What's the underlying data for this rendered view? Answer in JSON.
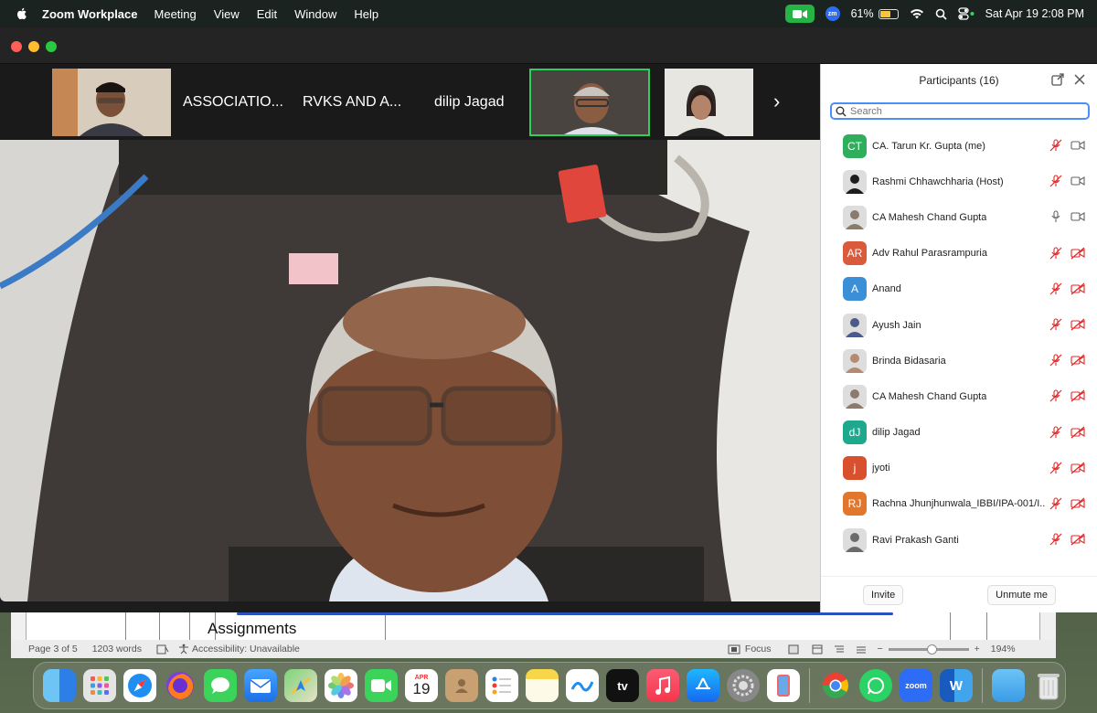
{
  "menubar": {
    "app_name": "Zoom Workplace",
    "menus": [
      "Meeting",
      "View",
      "Edit",
      "Window",
      "Help"
    ],
    "zm_badge": "zm",
    "battery_percent": "61%",
    "battery_level": 0.61,
    "datetime": "Sat Apr 19  2:08 PM"
  },
  "filmstrip": {
    "tiles": [
      {
        "label": "ASSOCIATIO..."
      },
      {
        "label": "RVKS AND A..."
      },
      {
        "label": "dilip Jagad"
      }
    ]
  },
  "panel": {
    "title": "Participants (16)",
    "search_placeholder": "Search",
    "participants": [
      {
        "name": "CA. Tarun Kr. Gupta (me)",
        "initials": "CT",
        "color": "#2fae5c",
        "photo": false,
        "mic_muted": true,
        "video_off": false
      },
      {
        "name": "Rashmi Chhawchharia (Host)",
        "initials": "",
        "color": "#1c1c1c",
        "photo": true,
        "mic_muted": true,
        "video_off": false
      },
      {
        "name": "CA Mahesh Chand Gupta",
        "initials": "",
        "color": "#8a7b6d",
        "photo": true,
        "mic_muted": false,
        "video_off": false
      },
      {
        "name": "Adv Rahul Parasrampuria",
        "initials": "AR",
        "color": "#d95b3c",
        "photo": false,
        "mic_muted": true,
        "video_off": true
      },
      {
        "name": "Anand",
        "initials": "A",
        "color": "#3b8fd6",
        "photo": false,
        "mic_muted": true,
        "video_off": true
      },
      {
        "name": "Ayush Jain",
        "initials": "",
        "color": "#4a5a8a",
        "photo": true,
        "mic_muted": true,
        "video_off": true
      },
      {
        "name": "Brinda Bidasaria",
        "initials": "",
        "color": "#b58a6e",
        "photo": true,
        "mic_muted": true,
        "video_off": true
      },
      {
        "name": "CA Mahesh Chand Gupta",
        "initials": "",
        "color": "#8a7b6d",
        "photo": true,
        "mic_muted": true,
        "video_off": true
      },
      {
        "name": "dilip Jagad",
        "initials": "dJ",
        "color": "#1ea88e",
        "photo": false,
        "mic_muted": true,
        "video_off": true
      },
      {
        "name": "jyoti",
        "initials": "j",
        "color": "#d9502c",
        "photo": false,
        "mic_muted": true,
        "video_off": true
      },
      {
        "name": "Rachna Jhunjhunwala_IBBI/IPA-001/I...",
        "initials": "RJ",
        "color": "#e2762c",
        "photo": false,
        "mic_muted": true,
        "video_off": true
      },
      {
        "name": "Ravi Prakash Ganti",
        "initials": "",
        "color": "#6b6b6b",
        "photo": true,
        "mic_muted": true,
        "video_off": true
      }
    ],
    "invite_label": "Invite",
    "unmute_label": "Unmute me"
  },
  "word": {
    "doc_text": "Assignments",
    "page_info": "Page 3 of 5",
    "word_count": "1203 words",
    "accessibility": "Accessibility: Unavailable",
    "focus_label": "Focus",
    "zoom_level": "194%"
  },
  "dock": {
    "calendar_month": "APR",
    "calendar_day": "19",
    "tv_label": "tv",
    "zoom_label": "zoom",
    "word_label": "W",
    "icons": [
      "finder-icon",
      "launchpad-icon",
      "safari-icon",
      "firefox-icon",
      "messages-icon",
      "mail-icon",
      "maps-icon",
      "photos-icon",
      "facetime-icon",
      "calendar-icon",
      "contacts-icon",
      "reminders-icon",
      "notes-icon",
      "freeform-icon",
      "apple-tv-icon",
      "music-icon",
      "app-store-icon",
      "system-settings-icon",
      "iphone-mirroring-icon",
      "chrome-icon",
      "whatsapp-icon",
      "zoom-icon",
      "word-icon",
      "downloads-folder-icon",
      "trash-icon"
    ]
  }
}
